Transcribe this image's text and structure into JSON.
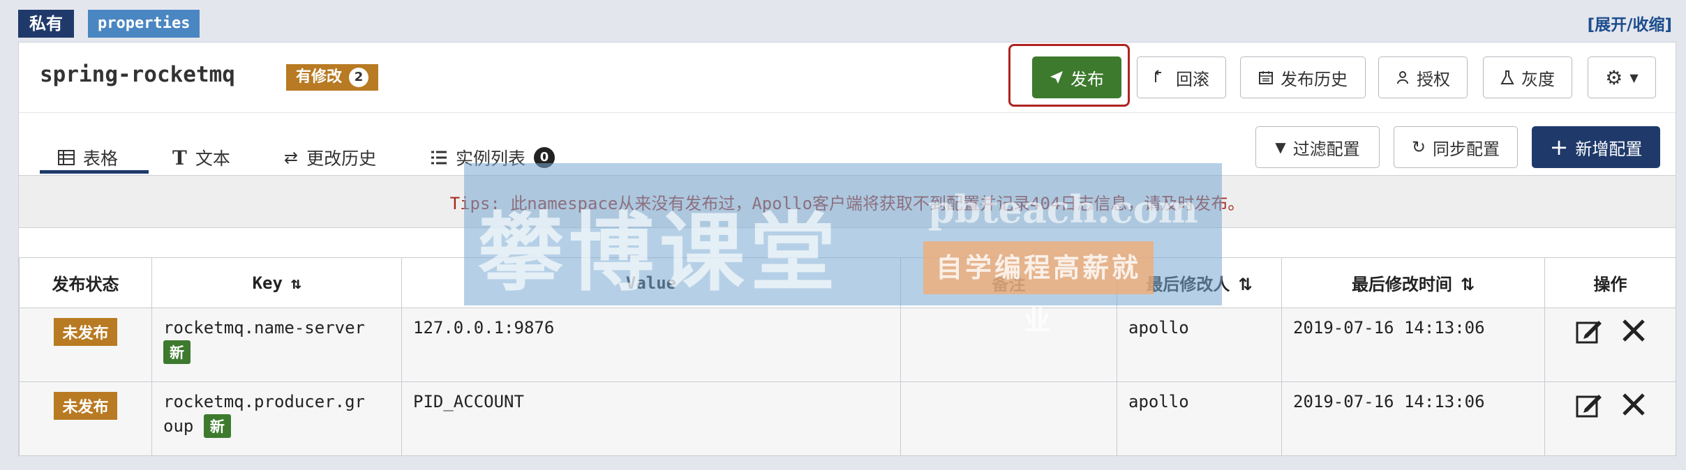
{
  "header": {
    "private_label": "私有",
    "format_label": "properties",
    "expand_label": "[展开/收缩]"
  },
  "namespace": {
    "name": "spring-rocketmq",
    "modified_label": "有修改",
    "modified_count": "2"
  },
  "toolbar": {
    "publish": "发布",
    "rollback": "回滚",
    "history": "发布历史",
    "grant": "授权",
    "gray": "灰度"
  },
  "tabs": [
    {
      "label": "表格",
      "icon": "table-icon"
    },
    {
      "label": "文本",
      "icon": "text-icon"
    },
    {
      "label": "更改历史",
      "icon": "exchange-icon"
    },
    {
      "label": "实例列表",
      "icon": "list-icon",
      "count": "0"
    }
  ],
  "actions": {
    "filter": "过滤配置",
    "sync": "同步配置",
    "add": "新增配置"
  },
  "tips": "Tips: 此namespace从来没有发布过，Apollo客户端将获取不到配置并记录404日志信息，请及时发布。",
  "table": {
    "headers": [
      "发布状态",
      "Key",
      "Value",
      "备注",
      "最后修改人",
      "最后修改时间",
      "操作"
    ],
    "rows": [
      {
        "status": "未发布",
        "key": "rocketmq.name-server",
        "new_label": "新",
        "value": "127.0.0.1:9876",
        "comment": "",
        "modifier": "apollo",
        "time": "2019-07-16 14:13:06"
      },
      {
        "status": "未发布",
        "key": "rocketmq.producer.gr oup",
        "new_label": "新",
        "value": "PID_ACCOUNT",
        "comment": "",
        "modifier": "apollo",
        "time": "2019-07-16 14:13:06"
      }
    ]
  },
  "watermark": {
    "brand": "攀博课堂",
    "url": "pbteach.com",
    "slogan": "自学编程高薪就业"
  },
  "colors": {
    "publish_green": "#3d7a2e",
    "primary_navy": "#1f3a6a",
    "badge_orange": "#b87a22",
    "tips_red": "#a5281c",
    "highlight_red": "#b02222"
  }
}
